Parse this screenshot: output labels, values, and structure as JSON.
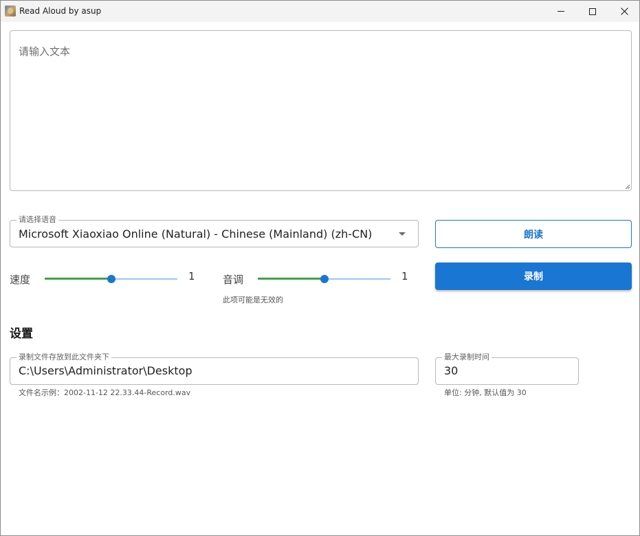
{
  "window": {
    "title": "Read Aloud by asup",
    "icon": "app-portrait-icon"
  },
  "text_input": {
    "placeholder": "请输入文本",
    "value": ""
  },
  "voice": {
    "legend": "请选择语音",
    "selected": "Microsoft Xiaoxiao Online (Natural) - Chinese (Mainland) (zh-CN)"
  },
  "speed": {
    "label": "速度",
    "value": "1",
    "level_fraction": 0.5
  },
  "pitch": {
    "label": "音调",
    "value": "1",
    "level_fraction": 0.5,
    "hint": "此项可能是无效的"
  },
  "buttons": {
    "read": "朗读",
    "record": "录制"
  },
  "settings": {
    "title": "设置",
    "folder": {
      "legend": "录制文件存放到此文件夹下",
      "value": "C:\\Users\\Administrator\\Desktop",
      "helper": "文件名示例：2002-11-12 22.33.44-Record.wav"
    },
    "max_time": {
      "legend": "最大录制时间",
      "value": "30",
      "helper": "单位: 分钟, 默认值为 30"
    }
  },
  "colors": {
    "primary": "#1976d2",
    "slider_track": "#43a047",
    "slider_rail": "#90caf9"
  }
}
